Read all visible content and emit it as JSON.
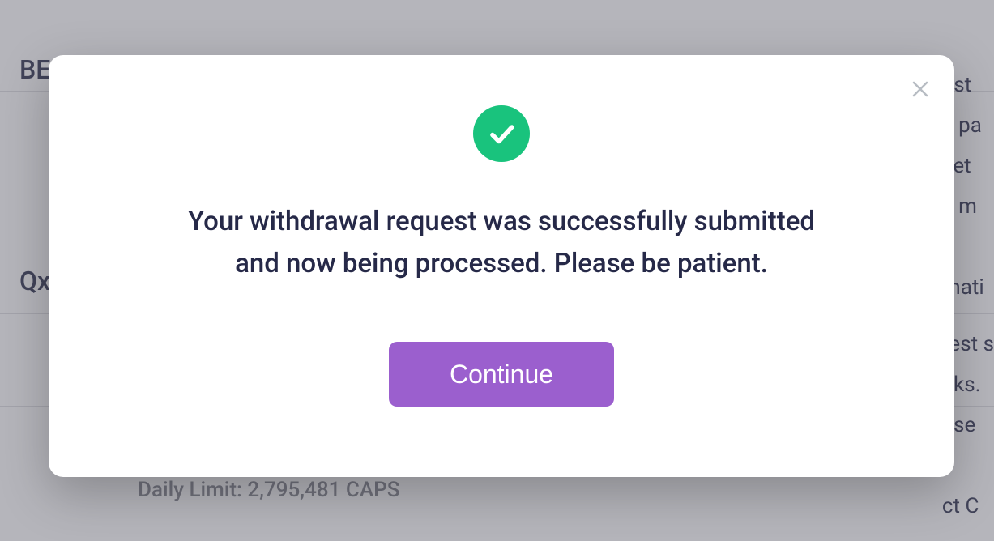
{
  "background": {
    "row1": "BE",
    "row2": "Qxfl",
    "dailyLimit": "Daily Limit: 2,795,481 CAPS",
    "rightLines1": "ust",
    "rightLines2": "e pa",
    "rightLines3": " set",
    "rightLines4": "e m",
    "rightLines5": "mati",
    "rightLines6": "test s",
    "rightLines7": "aks.",
    "rightLines8": "ase",
    "rightLines9": "ct C"
  },
  "modal": {
    "message": "Your withdrawal request was successfully submitted and now being processed. Please be patient.",
    "continueLabel": "Continue"
  },
  "colors": {
    "accent": "#9b5fce",
    "success": "#19c37d"
  }
}
